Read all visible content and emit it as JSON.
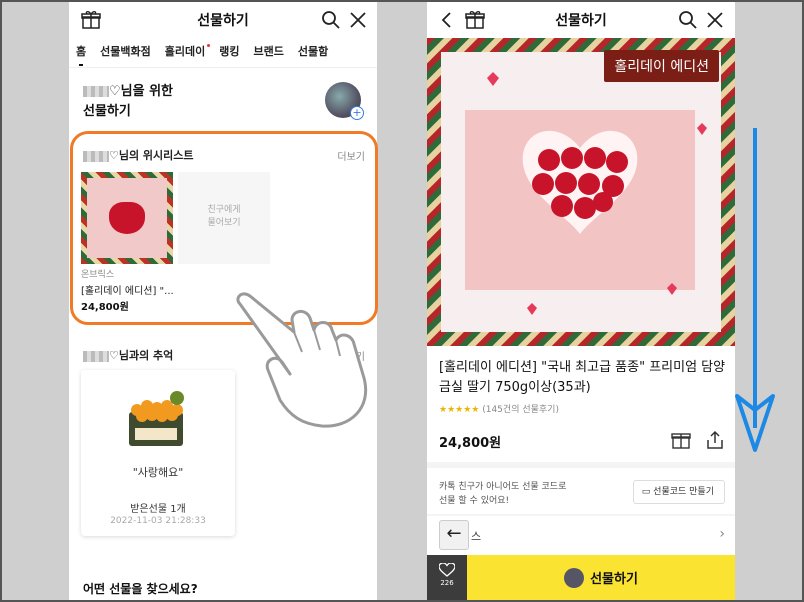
{
  "left": {
    "header": {
      "title": "선물하기"
    },
    "tabs": [
      "홈",
      "선물백화점",
      "홀리데이",
      "랭킹",
      "브랜드",
      "선물함"
    ],
    "greeting": {
      "line1_suffix": "♡님을 위한",
      "line2": "선물하기"
    },
    "wishlist": {
      "title_suffix": "♡님의 위시리스트",
      "more": "더보기",
      "ask_friend": "친구에게\n물어보기",
      "brand": "온브릭스",
      "product_name": "[홀리데이 에디션] \"...",
      "price": "24,800원"
    },
    "memories": {
      "title_suffix": "♡님과의 추억",
      "more_partial": "기",
      "message": "\"사랑해요\"",
      "received": "받은선물 1개",
      "date": "2022-11-03 21:28:33"
    },
    "find_question": "어떤 선물을 찾으세요?"
  },
  "right": {
    "header": {
      "title": "선물하기"
    },
    "hero_badge": "홀리데이 에디션",
    "product_title": "[홀리데이 에디션] \"국내 최고급 품종\" 프리미엄 담양 금실 딸기 750g이상(35과)",
    "stars": "★★★★★",
    "review_count": "(145건의 선물후기)",
    "price": "24,800원",
    "note": "카톡 친구가 아니어도 선물 코드로\n선물 할 수 있어요!",
    "code_button": "선물코드 만들기",
    "section_suffix": "스",
    "like_count": "226",
    "gift_button": "선물하기"
  },
  "colors": {
    "highlight": "#f07a26",
    "gift_yellow": "#fae331",
    "arrow_blue": "#1e88e5"
  }
}
